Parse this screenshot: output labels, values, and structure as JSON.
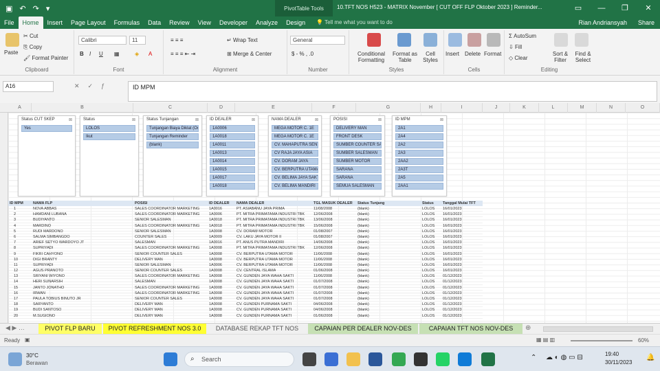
{
  "titlebar": {
    "contextual": "PivotTable Tools",
    "doc_title": "10.TFT NOS H523 - MATRIX November [ CUT OFF FLP Oktober 2023 ] Reminder...",
    "user": "Rian Andriansyah",
    "share": "Share"
  },
  "tabs": [
    "File",
    "Home",
    "Insert",
    "Page Layout",
    "Formulas",
    "Data",
    "Review",
    "View",
    "Developer",
    "Analyze",
    "Design"
  ],
  "tell_me": "Tell me what you want to do",
  "ribbon": {
    "clipboard": {
      "paste": "Paste",
      "cut": "Cut",
      "copy": "Copy",
      "format_painter": "Format Painter",
      "label": "Clipboard"
    },
    "font": {
      "name": "Calibri",
      "size": "11",
      "label": "Font"
    },
    "alignment": {
      "wrap": "Wrap Text",
      "merge": "Merge & Center",
      "label": "Alignment"
    },
    "number": {
      "format": "General",
      "label": "Number"
    },
    "styles": {
      "conditional": "Conditional Formatting",
      "format_table": "Format as Table",
      "cell_styles": "Cell Styles",
      "label": "Styles"
    },
    "cells": {
      "insert": "Insert",
      "delete": "Delete",
      "format": "Format",
      "label": "Cells"
    },
    "editing": {
      "autosum": "AutoSum",
      "fill": "Fill",
      "clear": "Clear",
      "sort": "Sort & Filter",
      "find": "Find & Select",
      "label": "Editing"
    }
  },
  "formula": {
    "cell_ref": "A16",
    "content": "ID MPM"
  },
  "columns": [
    "A",
    "B",
    "C",
    "D",
    "E",
    "F",
    "G",
    "H",
    "I",
    "J",
    "K",
    "L",
    "M",
    "N",
    "O"
  ],
  "slicers": [
    {
      "title": "Status CUT SKEP",
      "items": [
        "Yes"
      ]
    },
    {
      "title": "Status",
      "items": [
        "LOLOS",
        "Ikut"
      ]
    },
    {
      "title": "Status Tunjangan",
      "items": [
        "Tunjangan Biaya Diklat (Oct...",
        "Tunjangan Reminder",
        "(blank)"
      ]
    },
    {
      "title": "ID DEALER",
      "items": [
        "1A0006",
        "1A0018",
        "1A0011",
        "1A0013",
        "1A0014",
        "1A0015",
        "1A0017",
        "1A0018"
      ]
    },
    {
      "title": "NAMA DEALER",
      "items": [
        "MEGA MOTOR C. 1E",
        "MEGA MOTOR C. 1E",
        "CV. MAHAPUTRA SENTOSA",
        "CV RAJA JAYA ASIA",
        "CV. DORAM JAYA",
        "CV. BERPUTRA UTAMA",
        "CV. BELIMA JAYA SAKTI",
        "CV. BELIMA MANDIRI"
      ]
    },
    {
      "title": "POSISI",
      "items": [
        "DELIVERY MAN",
        "FRONT DESK",
        "SUMBER COUNTER SALES",
        "SUMBER SALESMAN",
        "SUMBER MOTOR",
        "SARANA",
        "SARANA",
        "SEMUA SALESMAN"
      ]
    },
    {
      "title": "ID MPM",
      "items": [
        "2A1",
        "2A4",
        "2A2",
        "2A3",
        "2AA2",
        "2A3T",
        "2A5",
        "2AA1"
      ]
    }
  ],
  "pivot_headers": [
    "ID MPM",
    "NAMA FLP",
    "POSISI",
    "ID DEALER",
    "NAMA DEALER",
    "TGL MASUK DEALER",
    "Status Tunjang",
    "Status",
    "Tanggal Mulai TFT"
  ],
  "pivot_rows": [
    [
      "1",
      "NOVA ABBAS",
      "SALES COORDINATOR MARKETING",
      "1A0016",
      "PT. ASIABANU JAYA PRIMA",
      "11/08/2008",
      "(blank)",
      "LOLOS",
      "16/01/2023"
    ],
    [
      "2",
      "HAMDANI LUBANA",
      "SALES COORDINATOR MARKETING",
      "1A0006",
      "PT. MITRA PRIMATAMA INDUSTRI TBK",
      "12/06/2008",
      "(blank)",
      "LOLOS",
      "16/01/2023"
    ],
    [
      "3",
      "BUDIYANTO",
      "SENIOR SALESMAN",
      "1A0018",
      "PT. MITRA PRIMATAMA INDUSTRI TBK",
      "13/06/2008",
      "(blank)",
      "LOLOS",
      "16/01/2023"
    ],
    [
      "4",
      "MARDINO",
      "SALES COORDINATOR MARKETING",
      "1A0018",
      "PT. MITRA PRIMATAMA INDUSTRI TBK",
      "15/06/2008",
      "(blank)",
      "LOLOS",
      "16/01/2023"
    ],
    [
      "5",
      "RUDI MARDONO",
      "SENIOR SALESMAN",
      "1A0008",
      "CV. DORAM MOTOR",
      "01/08/2007",
      "(blank)",
      "LOLOS",
      "16/01/2023"
    ],
    [
      "6",
      "SALMA SIMBANGDO",
      "COUNTER SALES",
      "1A0009",
      "CV. LAKU JAYA MOTOR II",
      "01/08/2007",
      "(blank)",
      "LOLOS",
      "16/01/2023"
    ],
    [
      "7",
      "ARIEF SETYO WARDOYO JT",
      "SALESMAN",
      "1A0016",
      "PT. ANUS PUTRA MANDIRI",
      "14/06/2008",
      "(blank)",
      "LOLOS",
      "16/01/2023"
    ],
    [
      "8",
      "SUPRIYADI",
      "SALES COORDINATOR MARKETING",
      "1A0008",
      "PT. MITRA PRIMATAMA INDUSTRI TBK",
      "12/06/2008",
      "(blank)",
      "LOLOS",
      "16/01/2023"
    ],
    [
      "9",
      "FIKRI CAHYONO",
      "SENIOR COUNTER SALES",
      "1A0008",
      "CV. BERPUTRA UTAMA MOTOR",
      "11/06/2008",
      "(blank)",
      "LOLOS",
      "16/01/2023"
    ],
    [
      "10",
      "DIGI BRANTY",
      "DELIVERY MAN",
      "1A0008",
      "CV. BERPUTRA UTAMA MOTOR",
      "11/06/2008",
      "(blank)",
      "LOLOS",
      "16/01/2023"
    ],
    [
      "11",
      "SUPRIYADI",
      "SENIOR SALESMAN",
      "1A0006",
      "CV. BERPUTRA UTAMA MOTOR",
      "11/06/2008",
      "(blank)",
      "LOLOS",
      "16/01/2023"
    ],
    [
      "12",
      "AGUS PRANOTO",
      "SENIOR COUNTER SALES",
      "1A0008",
      "CV. CENTRAL ISLAMA",
      "01/06/2008",
      "(blank)",
      "LOLOS",
      "16/01/2023"
    ],
    [
      "13",
      "SRIYANI WIYONO",
      "SALES COORDINATOR MARKETING",
      "1A0008",
      "CV. GUNDEN JAYA WAHA SAKTI",
      "11/06/2008",
      "(blank)",
      "LOLOS",
      "01/12/2023"
    ],
    [
      "14",
      "HERI SUNARSIH",
      "SALESMAN",
      "1A0008",
      "CV. GUNDEN JAYA WAHA SAKTI",
      "01/07/2008",
      "(blank)",
      "LOLOS",
      "01/12/2023"
    ],
    [
      "15",
      "JANTO JONATHO",
      "SALES COORDINATOR MARKETING",
      "1A0008",
      "CV. GUNDEN JAYA WAHA SAKTI",
      "01/07/2008",
      "(blank)",
      "LOLOS",
      "01/12/2023"
    ],
    [
      "16",
      "IRWAN",
      "SALES COORDINATOR MARKETING",
      "1A0008",
      "CV. GUNDEN JAYA WAHA SAKTI",
      "01/07/2008",
      "(blank)",
      "LOLOS",
      "01/12/2023"
    ],
    [
      "17",
      "PAULA TOBIUS BINUTO JR",
      "SENIOR COUNTER SALES",
      "1A0008",
      "CV. GUNDEN JAYA WAHA SAKTI",
      "01/07/2008",
      "(blank)",
      "LOLOS",
      "01/12/2023"
    ],
    [
      "18",
      "SARYANTO",
      "DELIVERY MAN",
      "1A0008",
      "CV. GUNDEN PURNAMA SAKTI",
      "04/06/2008",
      "(blank)",
      "LOLOS",
      "01/12/2023"
    ],
    [
      "19",
      "BUDI SANTOSO",
      "DELIVERY MAN",
      "1A0008",
      "CV. GUNDEN PURNAMA SAKTI",
      "04/06/2008",
      "(blank)",
      "LOLOS",
      "01/12/2023"
    ],
    [
      "20",
      "M.SUGIONO",
      "DELIVERY MAN",
      "1A0008",
      "CV. GUNDEN PURNAMA SAKTI",
      "01/06/2008",
      "(blank)",
      "LOLOS",
      "01/12/2023"
    ]
  ],
  "sheet_tabs": [
    {
      "label": "PIVOT FLP BARU",
      "bg": "#ffff66"
    },
    {
      "label": "PIVOT REFRESHMENT NOS 3.0",
      "bg": "#ffff33"
    },
    {
      "label": "DATABASE REKAP TFT NOS",
      "bg": "#f0f0f0"
    },
    {
      "label": "CAPAIAN PER DEALER NOV-DES",
      "bg": "#c6e0b4"
    },
    {
      "label": "CAPAIAN TFT NOS NOV-DES",
      "bg": "#c6e0b4"
    }
  ],
  "status": {
    "ready": "Ready",
    "zoom": "60%"
  },
  "taskbar": {
    "weather_temp": "30°C",
    "weather_desc": "Berawan",
    "search": "Search",
    "time": "19:40",
    "date": "30/11/2023"
  }
}
